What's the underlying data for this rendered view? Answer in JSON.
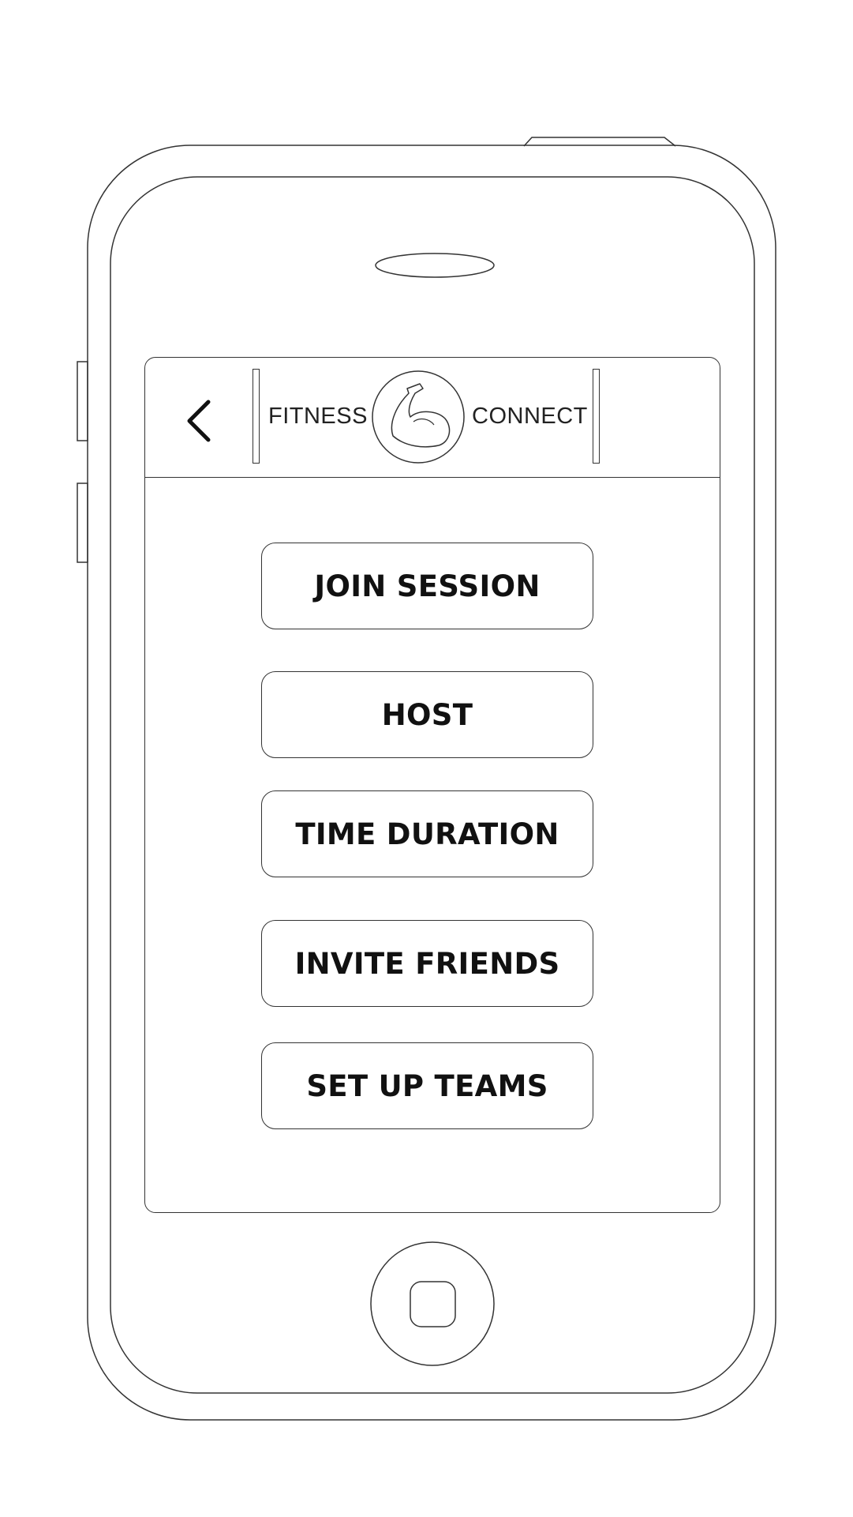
{
  "header": {
    "back_icon": "chevron-left-icon",
    "logo": {
      "left_word": "FITNESS",
      "right_word": "CONNECT",
      "emblem_icon": "flexed-bicep-icon"
    }
  },
  "menu": {
    "buttons": [
      {
        "label": "JOIN SESSION"
      },
      {
        "label": "HOST"
      },
      {
        "label": "TIME DURATION"
      },
      {
        "label": "INVITE FRIENDS"
      },
      {
        "label": "SET UP TEAMS"
      }
    ]
  },
  "device": {
    "home_button_icon": "home-button-icon",
    "speaker_icon": "earpiece-speaker-icon"
  },
  "colors": {
    "outline": "#333333",
    "text": "#111111",
    "background": "#ffffff"
  }
}
